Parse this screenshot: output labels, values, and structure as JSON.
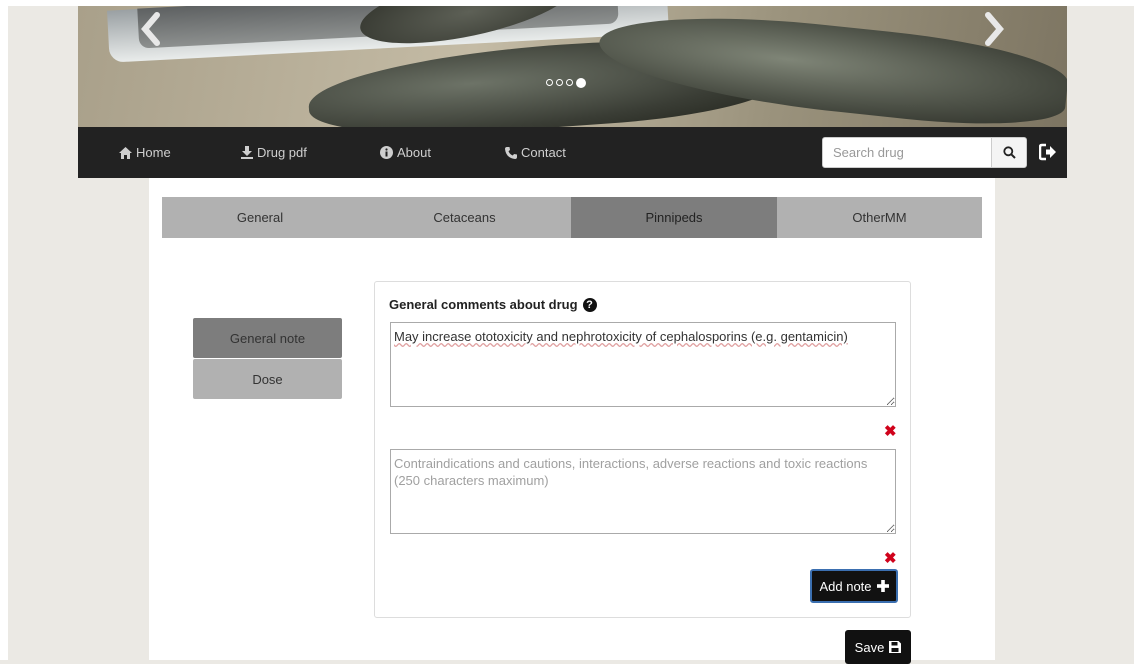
{
  "carousel": {
    "prev_icon": "chevron-left-icon",
    "next_icon": "chevron-right-icon",
    "slide_count": 4,
    "active_slide": 4
  },
  "nav": {
    "home": "Home",
    "drug_pdf": "Drug pdf",
    "about": "About",
    "contact": "Contact",
    "search_placeholder": "Search drug"
  },
  "tabs": [
    "General",
    "Cetaceans",
    "Pinnipeds",
    "OtherMM"
  ],
  "active_tab": "Pinnipeds",
  "side": {
    "general_note": "General note",
    "dose": "Dose"
  },
  "card": {
    "title": "General comments about drug",
    "note_value": "May increase ototoxicity and nephrotoxicity of cephalosporins (e.g. gentamicin)",
    "note_placeholder": "Contraindications and cautions, interactions, adverse reactions and toxic reactions (250 characters maximum)",
    "add_note": "Add note",
    "save": "Save"
  },
  "colors": {
    "navbar": "#222222",
    "tab_active": "#7d7d7d",
    "tab_inactive": "#b1b1b1",
    "delete": "#d0021b"
  }
}
